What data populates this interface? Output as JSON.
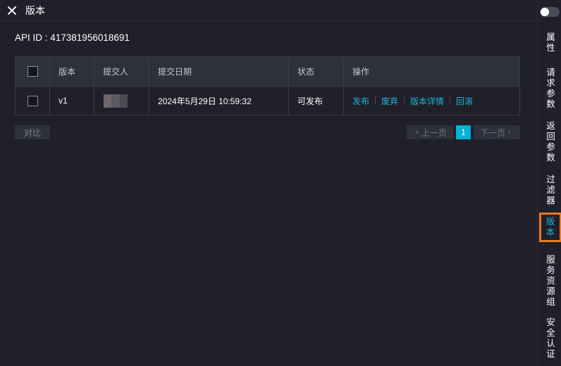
{
  "header": {
    "title": "版本"
  },
  "api": {
    "label": "API ID : 417381956018691"
  },
  "table": {
    "columns": [
      "版本",
      "提交人",
      "提交日期",
      "状态",
      "操作"
    ],
    "rows": [
      {
        "version": "v1",
        "submitter": "",
        "date": "2024年5月29日 10:59:32",
        "status": "可发布",
        "ops": [
          "发布",
          "废弃",
          "版本详情",
          "回滚"
        ]
      }
    ]
  },
  "footer": {
    "compare_label": "对比",
    "prev_label": "上一页",
    "next_label": "下一页",
    "current_page": "1"
  },
  "sidebar": {
    "items": [
      {
        "label": "属性",
        "chars": [
          "属",
          "性"
        ]
      },
      {
        "label": "请求参数",
        "chars": [
          "请",
          "求",
          "参",
          "数"
        ]
      },
      {
        "label": "返回参数",
        "chars": [
          "返",
          "回",
          "参",
          "数"
        ]
      },
      {
        "label": "过滤器",
        "chars": [
          "过",
          "滤",
          "器"
        ]
      },
      {
        "label": "版本",
        "chars": [
          "版",
          "本"
        ],
        "active": true
      },
      {
        "label": "服务资源组",
        "chars": [
          "服",
          "务",
          "资",
          "源",
          "组"
        ]
      },
      {
        "label": "安全认证",
        "chars": [
          "安",
          "全",
          "认",
          "证"
        ]
      }
    ]
  },
  "colors": {
    "accent": "#00b2d4",
    "link": "#1fb3d6",
    "active_border": "#e87a24"
  }
}
